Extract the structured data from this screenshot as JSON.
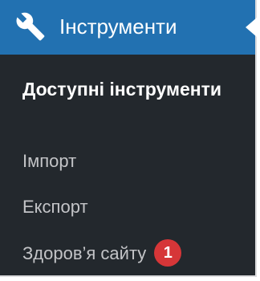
{
  "menu": {
    "header": {
      "icon": "wrench-icon",
      "title": "Інструменти"
    },
    "items": [
      {
        "label": "Доступні інструменти",
        "current": true
      },
      {
        "label": "Імпорт"
      },
      {
        "label": "Експорт"
      },
      {
        "label": "Здоров’я сайту",
        "badge": "1"
      }
    ]
  },
  "colors": {
    "menu_background": "#23282d",
    "header_background": "#2271b1",
    "item_text": "#c3c4c7",
    "current_text": "#ffffff",
    "badge_background": "#d63638"
  }
}
